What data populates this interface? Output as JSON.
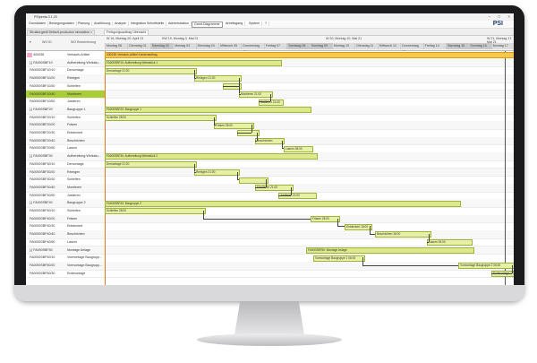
{
  "window": {
    "title": "PSIpenta 3.1.20",
    "brand": "PSI"
  },
  "window_controls": [
    "–",
    "□",
    "×"
  ],
  "menu": [
    "Grunddaten",
    "Bewegungsdaten",
    "Planung",
    "Ausführung",
    "Analyse",
    "Integration Schnittstelle",
    "Administration",
    "Gantt-Diagramme",
    "Arbeitsgang",
    "System",
    "?"
  ],
  "active_menu": "Gantt-Diagramme",
  "tabs": [
    "Strukturgantt Default-produzion simulation ×",
    "Fertigungsauftrag Übersicht"
  ],
  "grid": {
    "col_id": "WO ID",
    "col_bez": "WO Bezeichnung"
  },
  "weeks": [
    "W 16, Montag 20. April 21",
    "KW 19, Montag 3. Mai 21",
    "W 20, Montag 10. Mai 21",
    "W 21, Montag 17. Mai 21"
  ],
  "days": [
    "Montag 08",
    "Dienstag 01",
    "Samstag 02",
    "Montag 03",
    "Dienstag 04",
    "Mittwoch 05",
    "Donnerstag 06",
    "Freitag 07",
    "Samstag 08",
    "Sonntag 09",
    "Montag 10",
    "Dienstag 11",
    "Mittwoch 12",
    "Donnerstag 13",
    "Freitag 14",
    "Samstag 15",
    "Sonntag 16",
    "Montag 17"
  ],
  "rows": [
    {
      "id": "[-] 400038",
      "bez": "Verkaufs-Artikel"
    },
    {
      "id": "[-] FA000SBF10",
      "bez": "Aufbereitung Werkstu..."
    },
    {
      "id": "FA0000SBF10/10",
      "bez": "Demontage"
    },
    {
      "id": "FA0000SBF10/20",
      "bez": "Reinigen"
    },
    {
      "id": "FA0000SBF10/30",
      "bez": "Schleifen"
    },
    {
      "id": "FA0000SBF10/40",
      "bez": "Montieren"
    },
    {
      "id": "FA0000SBF10/50",
      "bez": "Justieren"
    },
    {
      "id": "[-] FA000SBF20",
      "bez": "Baugruppe 1"
    },
    {
      "id": "FA0000SBF20/10",
      "bez": "Schleifen"
    },
    {
      "id": "FA0000SBF20/20",
      "bez": "Fräsen"
    },
    {
      "id": "FA0000SBF20/30",
      "bez": "Entdeckert"
    },
    {
      "id": "FA0000SBF20/40",
      "bez": "Beschichten"
    },
    {
      "id": "FA0000SBF20/50",
      "bez": "Lasern"
    },
    {
      "id": "[-] FA000SBF30",
      "bez": "Aufbereitung Werkstu..."
    },
    {
      "id": "FA0000SBF30/10",
      "bez": "Demontage"
    },
    {
      "id": "FA0000SBF30/20",
      "bez": "Reinigen"
    },
    {
      "id": "FA0000SBF30/30",
      "bez": "Schleifen"
    },
    {
      "id": "FA0000SBF30/40",
      "bez": "Montieren"
    },
    {
      "id": "FA0000SBF30/50",
      "bez": "Justieren"
    },
    {
      "id": "[-] FA000SBF40",
      "bez": "Baugruppe 2"
    },
    {
      "id": "FA0000SBF40/10",
      "bez": "Schleifen"
    },
    {
      "id": "FA0000SBF40/20",
      "bez": "Fräsen"
    },
    {
      "id": "FA0000SBF40/30",
      "bez": "Entdeckert"
    },
    {
      "id": "FA0000SBF40/40",
      "bez": "Beschichten"
    },
    {
      "id": "FA0000SBF40/50",
      "bez": "Lasern"
    },
    {
      "id": "[-] FA000SBF50",
      "bez": "Montage Anlage"
    },
    {
      "id": "FA0000SBF50/10",
      "bez": "Vormontage Baugrupp..."
    },
    {
      "id": "FA0000SBF50/20",
      "bez": "Vormontage Baugrupp..."
    },
    {
      "id": "FA0000SBF50/30",
      "bez": "Endmontage"
    }
  ],
  "selected_row": 5,
  "bars": [
    {
      "row": 0,
      "label": "400038: Verkaufs-Artikel Kundenauftrag",
      "kind": "first"
    },
    {
      "row": 1,
      "label": "FA000SBF10: Aufbereitung Werkstück 1",
      "kind": "sum"
    },
    {
      "row": 2,
      "label": "Demontage 21:00",
      "kind": "op"
    },
    {
      "row": 3,
      "label": "Reinigen 21:00",
      "kind": "op"
    },
    {
      "row": 4,
      "label": "",
      "kind": "op"
    },
    {
      "row": 5,
      "label": "Montieren 21:00",
      "kind": "op"
    },
    {
      "row": 6,
      "label": "Justieren 21:00",
      "kind": "op"
    },
    {
      "row": 7,
      "label": "FA000SBF20: Baugruppe 1",
      "kind": "sum"
    },
    {
      "row": 8,
      "label": "Schleifen 28:00",
      "kind": "op"
    },
    {
      "row": 9,
      "label": "Fräsen 28:00",
      "kind": "op"
    },
    {
      "row": 10,
      "label": "",
      "kind": "op"
    },
    {
      "row": 11,
      "label": "Beschichten",
      "kind": "op"
    },
    {
      "row": 12,
      "label": "Lasern 28:00",
      "kind": "op"
    },
    {
      "row": 13,
      "label": "FA000SBF30: Aufbereitung Werkstück 2",
      "kind": "sum"
    },
    {
      "row": 14,
      "label": "Demontage 21:00",
      "kind": "op"
    },
    {
      "row": 15,
      "label": "Reinigen 21:00",
      "kind": "op"
    },
    {
      "row": 16,
      "label": "",
      "kind": "op"
    },
    {
      "row": 17,
      "label": "Montieren 21:00",
      "kind": "op"
    },
    {
      "row": 18,
      "label": "Justieren 21:00",
      "kind": "op"
    },
    {
      "row": 19,
      "label": "FA000SBF40: Baugruppe 2",
      "kind": "sum"
    },
    {
      "row": 20,
      "label": "Schleifen 28:00",
      "kind": "op"
    },
    {
      "row": 21,
      "label": "Fräsen 28:00",
      "kind": "op"
    },
    {
      "row": 22,
      "label": "Entdeckert 18:00",
      "kind": "op"
    },
    {
      "row": 23,
      "label": "Beschichten 18:00",
      "kind": "op"
    },
    {
      "row": 24,
      "label": "Lasern 18:00",
      "kind": "op"
    },
    {
      "row": 25,
      "label": "FA000SBF50: Montage Anlage",
      "kind": "sum"
    },
    {
      "row": 26,
      "label": "Vormontage Baugruppe 1 06:00",
      "kind": "op"
    },
    {
      "row": 27,
      "label": "Vormontage Baugruppe 2 06:00",
      "kind": "op"
    },
    {
      "row": 28,
      "label": "Endmontage 7:00",
      "kind": "op"
    }
  ],
  "colors": {
    "selection": "#aacd37",
    "bar_fill": "#e8f0a6",
    "bar_border": "#9fb43a",
    "first_bar": "#f7c84c",
    "today_line": "#e07820"
  }
}
